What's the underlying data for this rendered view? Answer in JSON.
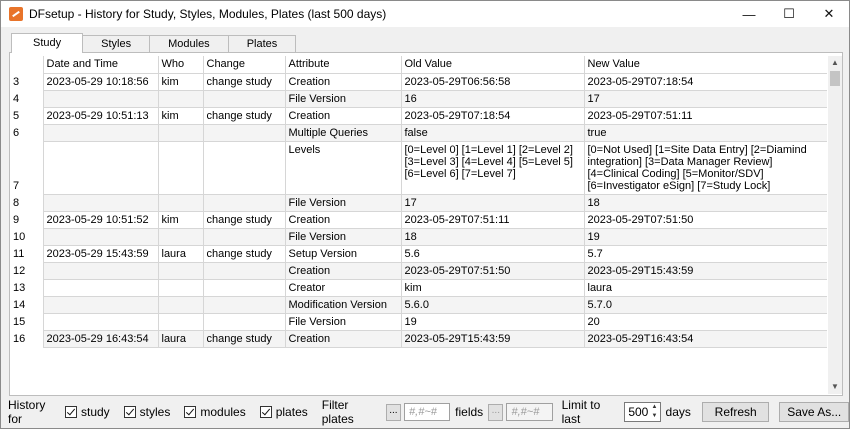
{
  "window": {
    "title": "DFsetup - History for Study, Styles, Modules, Plates (last 500 days)",
    "controls": {
      "minimize": "—",
      "maximize": "☐",
      "close": "✕"
    }
  },
  "tabs": [
    {
      "label": "Study",
      "active": true
    },
    {
      "label": "Styles",
      "active": false
    },
    {
      "label": "Modules",
      "active": false
    },
    {
      "label": "Plates",
      "active": false
    }
  ],
  "table": {
    "headers": [
      "Date and Time",
      "Who",
      "Change",
      "Attribute",
      "Old Value",
      "New Value"
    ],
    "rows": [
      {
        "num": "3",
        "date": "2023-05-29 10:18:56",
        "who": "kim",
        "change": "change study",
        "attr": "Creation",
        "old": "2023-05-29T06:56:58",
        "new": "2023-05-29T07:18:54"
      },
      {
        "num": "4",
        "date": "",
        "who": "",
        "change": "",
        "attr": "File Version",
        "old": "16",
        "new": "17"
      },
      {
        "num": "5",
        "date": "2023-05-29 10:51:13",
        "who": "kim",
        "change": "change study",
        "attr": "Creation",
        "old": "2023-05-29T07:18:54",
        "new": "2023-05-29T07:51:11"
      },
      {
        "num": "6",
        "date": "",
        "who": "",
        "change": "",
        "attr": "Multiple Queries",
        "old": "false",
        "new": "true"
      },
      {
        "num": "7",
        "date": "",
        "who": "",
        "change": "",
        "attr": "Levels",
        "old": "[0=Level 0] [1=Level 1] [2=Level 2] [3=Level 3] [4=Level 4] [5=Level 5] [6=Level 6] [7=Level 7]",
        "new": "[0=Not Used] [1=Site Data Entry] [2=Diamind integration] [3=Data Manager Review] [4=Clinical Coding] [5=Monitor/SDV] [6=Investigator eSign] [7=Study Lock]"
      },
      {
        "num": "8",
        "date": "",
        "who": "",
        "change": "",
        "attr": "File Version",
        "old": "17",
        "new": "18"
      },
      {
        "num": "9",
        "date": "2023-05-29 10:51:52",
        "who": "kim",
        "change": "change study",
        "attr": "Creation",
        "old": "2023-05-29T07:51:11",
        "new": "2023-05-29T07:51:50"
      },
      {
        "num": "10",
        "date": "",
        "who": "",
        "change": "",
        "attr": "File Version",
        "old": "18",
        "new": "19"
      },
      {
        "num": "11",
        "date": "2023-05-29 15:43:59",
        "who": "laura",
        "change": "change study",
        "attr": "Setup Version",
        "old": "5.6",
        "new": "5.7"
      },
      {
        "num": "12",
        "date": "",
        "who": "",
        "change": "",
        "attr": "Creation",
        "old": "2023-05-29T07:51:50",
        "new": "2023-05-29T15:43:59"
      },
      {
        "num": "13",
        "date": "",
        "who": "",
        "change": "",
        "attr": "Creator",
        "old": "kim",
        "new": "laura"
      },
      {
        "num": "14",
        "date": "",
        "who": "",
        "change": "",
        "attr": "Modification Version",
        "old": "5.6.0",
        "new": "5.7.0"
      },
      {
        "num": "15",
        "date": "",
        "who": "",
        "change": "",
        "attr": "File Version",
        "old": "19",
        "new": "20"
      },
      {
        "num": "16",
        "date": "2023-05-29 16:43:54",
        "who": "laura",
        "change": "change study",
        "attr": "Creation",
        "old": "2023-05-29T15:43:59",
        "new": "2023-05-29T16:43:54"
      }
    ]
  },
  "bottom": {
    "history_for_label": "History for",
    "checkboxes": [
      {
        "label": "study",
        "checked": true
      },
      {
        "label": "styles",
        "checked": true
      },
      {
        "label": "modules",
        "checked": true
      },
      {
        "label": "plates",
        "checked": true
      }
    ],
    "filter_plates_label": "Filter plates",
    "dots_label": "...",
    "filter_plates_placeholder": "#,#~#",
    "fields_label": "fields",
    "fields_placeholder": "#,#~#",
    "limit_label": "Limit to last",
    "limit_value": "500",
    "days_label": "days",
    "refresh_label": "Refresh",
    "save_as_label": "Save As..."
  }
}
